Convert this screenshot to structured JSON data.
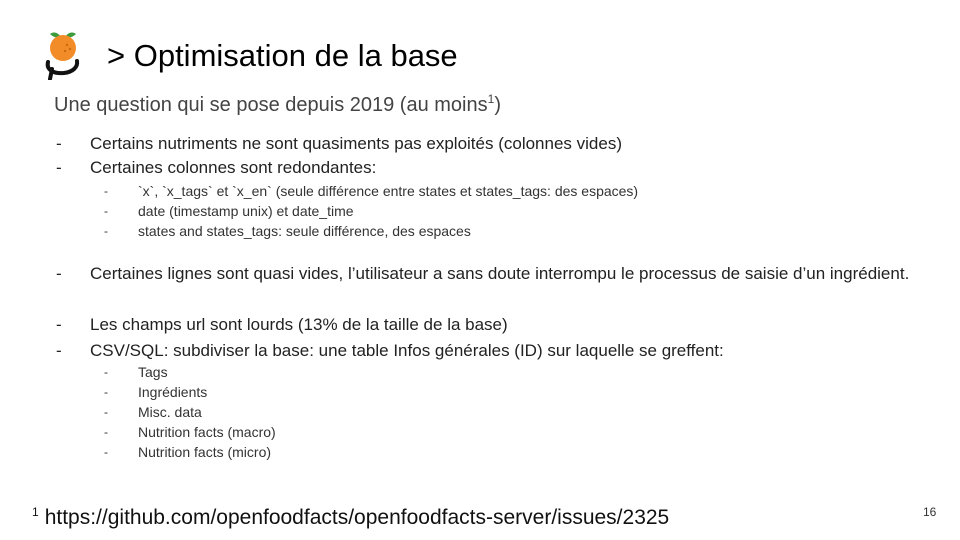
{
  "slide": {
    "title": "> Optimisation de la base",
    "subtitle": "Une question qui se pose depuis 2019 (au moins",
    "subtitle_ref": "1",
    "subtitle_close": ")",
    "page_number": "16"
  },
  "bullets": [
    {
      "text": "Certains nutriments ne sont quasiments pas exploités (colonnes vides)"
    },
    {
      "text": "Certaines colonnes sont redondantes:",
      "sub": [
        "`x`, `x_tags` et `x_en` (seule différence entre states et states_tags: des espaces)",
        "date (timestamp unix) et date_time",
        "states and states_tags: seule différence, des espaces"
      ]
    },
    {
      "text": "Certaines lignes sont quasi vides, l’utilisateur a sans doute interrompu le processus de saisie d’un ingrédient."
    },
    {
      "text": "Les champs url sont lourds (13% de la taille de la base)"
    },
    {
      "text": "CSV/SQL: subdiviser la base: une table Infos générales (ID) sur laquelle se greffent:",
      "sub": [
        "Tags",
        "Ingrédients",
        "Misc. data",
        "Nutrition facts (macro)",
        "Nutrition facts (micro)"
      ]
    }
  ],
  "dash": "-",
  "footnote": {
    "ref": "1",
    "url": "https://github.com/openfoodfacts/openfoodfacts-server/issues/2325"
  },
  "logo": {
    "icon": "open-food-facts-logo-icon",
    "orange": "#f28c28",
    "leaf": "#3d9a3d",
    "stroke": "#111111"
  }
}
